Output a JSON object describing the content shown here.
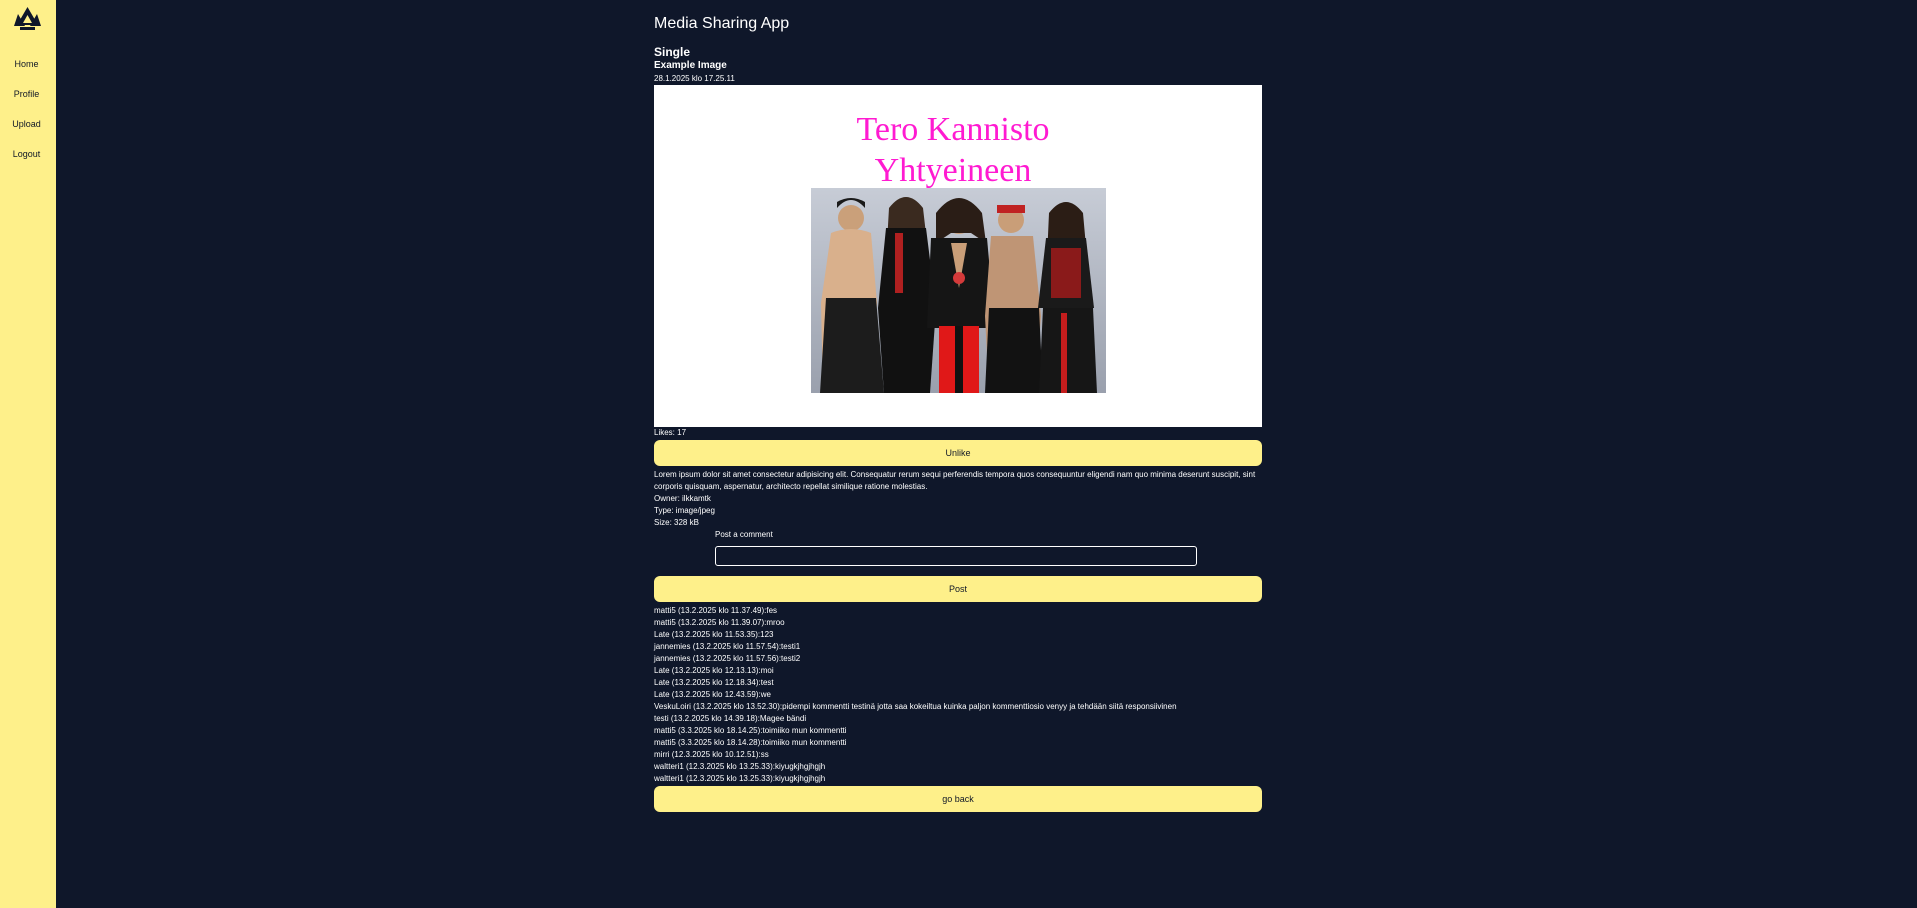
{
  "sidebar": {
    "logo": "band-logo-icon",
    "items": [
      {
        "label": "Home"
      },
      {
        "label": "Profile"
      },
      {
        "label": "Upload"
      },
      {
        "label": "Logout"
      }
    ]
  },
  "app_title": "Media Sharing App",
  "page_heading": "Single",
  "media": {
    "title": "Example Image",
    "date": "28.1.2025 klo 17.25.11",
    "caption_line1": "Tero Kannisto",
    "caption_line2": "Yhtyeineen",
    "likes": "Likes: 17",
    "description": "Lorem ipsum dolor sit amet consectetur adipisicing elit. Consequatur rerum sequi perferendis tempora quos consequuntur eligendi nam quo minima deserunt suscipit, sint corporis quisquam, aspernatur, architecto repellat similique ratione molestias.",
    "owner": "Owner: ilkkamtk",
    "type": "Type: image/jpeg",
    "size": "Size: 328 kB"
  },
  "buttons": {
    "unlike": "Unlike",
    "post": "Post",
    "go_back": "go back"
  },
  "comment_form": {
    "label": "Post a comment",
    "value": ""
  },
  "comments": [
    "matti5 (13.2.2025 klo 11.37.49):fes",
    "matti5 (13.2.2025 klo 11.39.07):mroo",
    "Late (13.2.2025 klo 11.53.35):123",
    "jannemies (13.2.2025 klo 11.57.54):testi1",
    "jannemies (13.2.2025 klo 11.57.56):testi2",
    "Late (13.2.2025 klo 12.13.13):moi",
    "Late (13.2.2025 klo 12.18.34):test",
    "Late (13.2.2025 klo 12.43.59):we",
    "VeskuLoiri (13.2.2025 klo 13.52.30):pidempi kommentti testinä jotta saa kokeiltua kuinka paljon kommenttiosio venyy ja tehdään siitä responsiivinen",
    "testi (13.2.2025 klo 14.39.18):Magee bändi",
    "matti5 (3.3.2025 klo 18.14.25):toimiiko mun kommentti",
    "matti5 (3.3.2025 klo 18.14.28):toimiiko mun kommentti",
    "mirri (12.3.2025 klo 10.12.51):ss",
    "waltteri1 (12.3.2025 klo 13.25.33):kiyugkjhgjhgjh",
    "waltteri1 (12.3.2025 klo 13.25.33):kiyugkjhgjhgjh"
  ]
}
